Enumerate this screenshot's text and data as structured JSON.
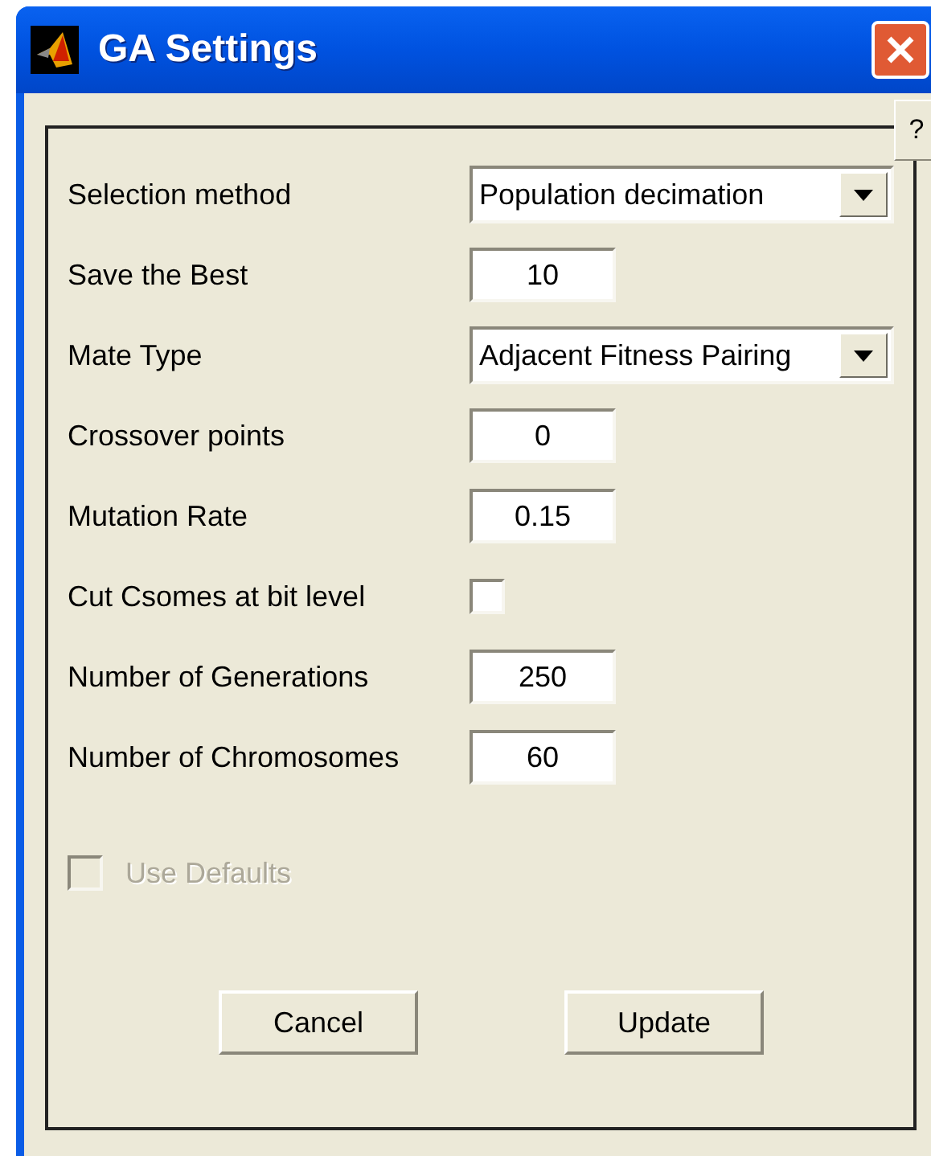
{
  "window": {
    "title": "GA Settings"
  },
  "help_button": "?",
  "settings": [
    {
      "kind": "dropdown",
      "label": "Selection method",
      "value": "Population decimation"
    },
    {
      "kind": "number",
      "label": "Save the Best",
      "value": "10"
    },
    {
      "kind": "dropdown",
      "label": "Mate Type",
      "value": "Adjacent Fitness Pairing"
    },
    {
      "kind": "number",
      "label": "Crossover points",
      "value": "0"
    },
    {
      "kind": "number",
      "label": "Mutation Rate",
      "value": "0.15"
    },
    {
      "kind": "checkbox",
      "label": "Cut Csomes at bit level",
      "checked": false
    },
    {
      "kind": "number",
      "label": "Number of Generations",
      "value": "250"
    },
    {
      "kind": "number",
      "label": "Number of Chromosomes",
      "value": "60"
    }
  ],
  "use_defaults": {
    "label": "Use Defaults",
    "checked": false,
    "disabled": true
  },
  "buttons": [
    "Cancel",
    "Update"
  ]
}
